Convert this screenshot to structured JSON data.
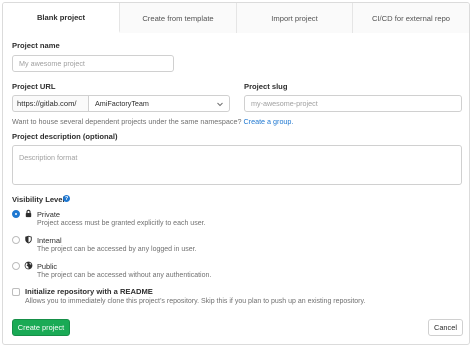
{
  "tabs": [
    {
      "label": "Blank project"
    },
    {
      "label": "Create from template"
    },
    {
      "label": "Import project"
    },
    {
      "label": "CI/CD for external repo"
    }
  ],
  "project_name": {
    "label": "Project name",
    "placeholder": "My awesome project"
  },
  "project_url": {
    "label": "Project URL",
    "prefix": "https://gitlab.com/",
    "namespace": "AmiFactoryTeam"
  },
  "project_slug": {
    "label": "Project slug",
    "placeholder": "my-awesome-project"
  },
  "group_hint": {
    "text": "Want to house several dependent projects under the same namespace?",
    "link": "Create a group."
  },
  "description": {
    "label": "Project description (optional)",
    "placeholder": "Description format"
  },
  "visibility": {
    "label": "Visibility Level",
    "help": "?",
    "options": [
      {
        "name": "Private",
        "desc": "Project access must be granted explicitly to each user.",
        "icon": "lock-icon",
        "checked": true
      },
      {
        "name": "Internal",
        "desc": "The project can be accessed by any logged in user.",
        "icon": "shield-icon",
        "checked": false
      },
      {
        "name": "Public",
        "desc": "The project can be accessed without any authentication.",
        "icon": "globe-icon",
        "checked": false
      }
    ]
  },
  "init_readme": {
    "label": "Initialize repository with a README",
    "desc": "Allows you to immediately clone this project’s repository. Skip this if you plan to push up an existing repository."
  },
  "actions": {
    "create": "Create project",
    "cancel": "Cancel"
  },
  "colors": {
    "primary": "#1aaa55",
    "link": "#1f78d1"
  }
}
